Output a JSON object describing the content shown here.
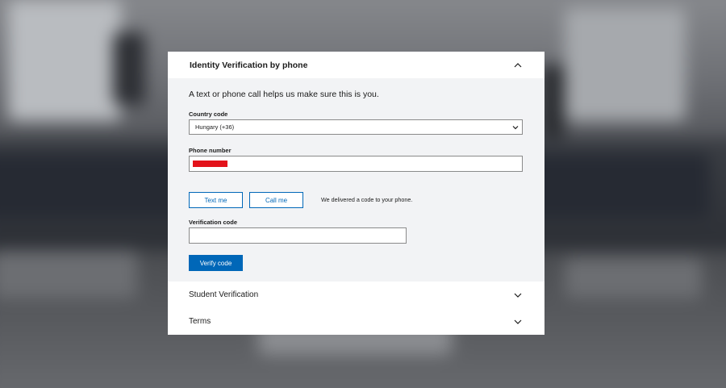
{
  "sections": {
    "phone": {
      "title": "Identity Verification by phone",
      "intro": "A text or phone call helps us make sure this is you.",
      "country_label": "Country code",
      "country_value": "Hungary (+36)",
      "phone_label": "Phone number",
      "phone_value_redacted": true,
      "text_me": "Text me",
      "call_me": "Call me",
      "delivered_msg": "We delivered a code to your phone.",
      "verification_label": "Verification code",
      "verification_value": "",
      "verify_button": "Verify code",
      "expanded": true
    },
    "student": {
      "title": "Student Verification",
      "expanded": false
    },
    "terms": {
      "title": "Terms",
      "expanded": false
    }
  },
  "colors": {
    "accent": "#0067b8",
    "redaction": "#e3131b",
    "panel_bg": "#f2f3f5"
  },
  "icons": {
    "collapse": "chevron-up-icon",
    "expand": "chevron-down-icon",
    "select_caret": "chevron-down-icon"
  }
}
